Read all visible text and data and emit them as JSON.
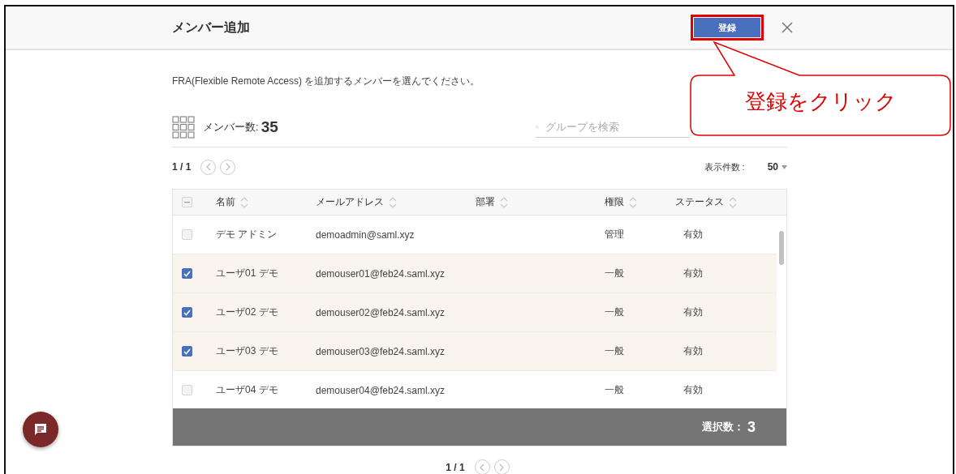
{
  "dialog": {
    "title": "メンバー追加",
    "register_button": "登録",
    "register_highlighted": true
  },
  "description": "FRA(Flexible Remote Access) を追加するメンバーを選んでください。",
  "member_count": {
    "label": "メンバー数:",
    "value": "35"
  },
  "search": {
    "placeholder": "グループを検索"
  },
  "pagination_top": {
    "page": "1 / 1"
  },
  "page_size": {
    "label": "表示件数 :",
    "value": "50"
  },
  "table": {
    "select_all": {
      "partial": true
    },
    "columns": [
      "名前",
      "メールアドレス",
      "部署",
      "権限",
      "ステータス"
    ],
    "rows": [
      {
        "name": "デモ アドミン",
        "email": "demoadmin@saml.xyz",
        "role": "管理",
        "status": "有効",
        "checked": false
      },
      {
        "name": "ユーザ01 デモ",
        "email": "demouser01@feb24.saml.xyz",
        "role": "一般",
        "status": "有効",
        "checked": true
      },
      {
        "name": "ユーザ02 デモ",
        "email": "demouser02@feb24.saml.xyz",
        "role": "一般",
        "status": "有効",
        "checked": true
      },
      {
        "name": "ユーザ03 デモ",
        "email": "demouser03@feb24.saml.xyz",
        "role": "一般",
        "status": "有効",
        "checked": true
      },
      {
        "name": "ユーザ04 デモ",
        "email": "demouser04@feb24.saml.xyz",
        "role": "一般",
        "status": "有効",
        "checked": false
      }
    ]
  },
  "selection_bar": {
    "label": "選択数：",
    "value": "3"
  },
  "pagination_bottom": {
    "page": "1 / 1"
  },
  "annotation": {
    "text": "登録をクリック"
  }
}
